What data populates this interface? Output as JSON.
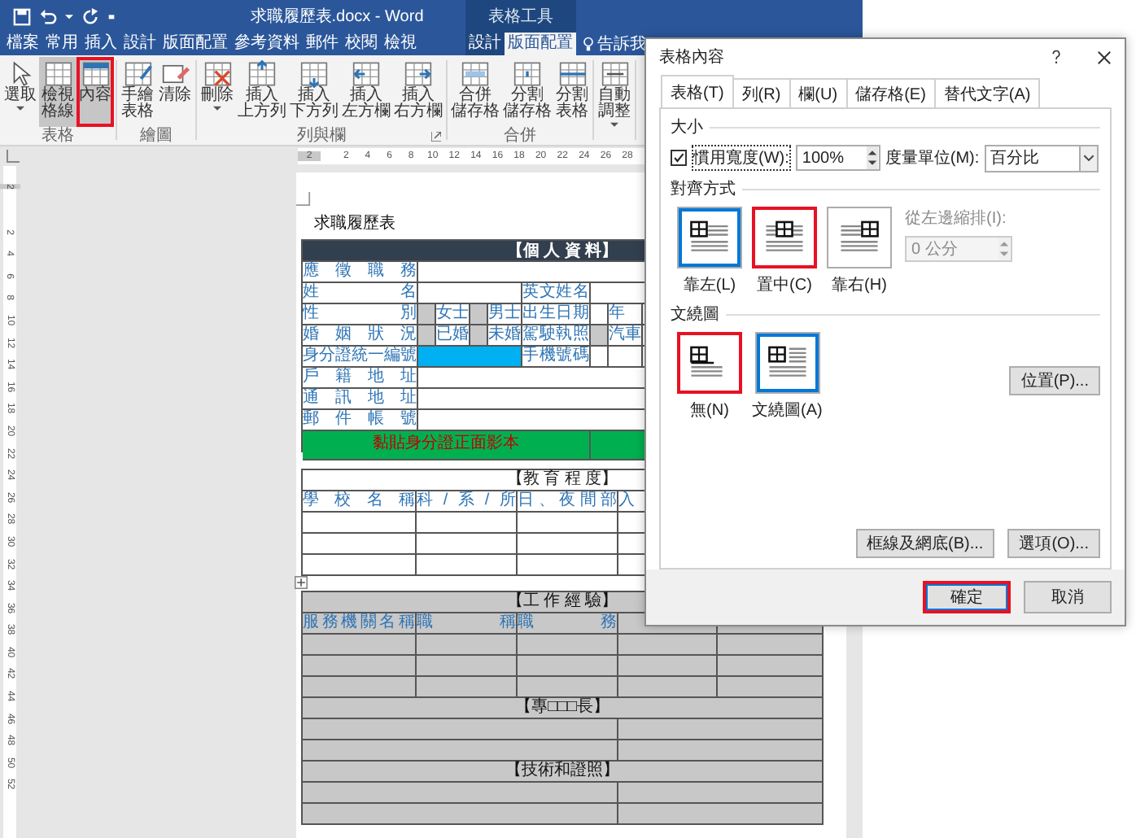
{
  "title_bar": {
    "title": "求職履歷表.docx - Word",
    "context_title": "表格工具"
  },
  "ribbon_tabs": [
    {
      "label": "檔案",
      "selected": false,
      "context": false
    },
    {
      "label": "常用",
      "selected": false,
      "context": false
    },
    {
      "label": "插入",
      "selected": false,
      "context": false
    },
    {
      "label": "設計",
      "selected": false,
      "context": false
    },
    {
      "label": "版面配置",
      "selected": false,
      "context": false
    },
    {
      "label": "參考資料",
      "selected": false,
      "context": false
    },
    {
      "label": "郵件",
      "selected": false,
      "context": false
    },
    {
      "label": "校閱",
      "selected": false,
      "context": false
    },
    {
      "label": "檢視",
      "selected": false,
      "context": false
    },
    {
      "label": "設計",
      "selected": false,
      "context": true
    },
    {
      "label": "版面配置",
      "selected": true,
      "context": true
    }
  ],
  "tell_me": "告訴我",
  "ribbon_groups": [
    {
      "label": "表格",
      "launcher": false,
      "buttons": [
        {
          "label": "選取",
          "pressed": false,
          "highlighted": false,
          "dropdown": true
        },
        {
          "label": "檢視格線",
          "pressed": true,
          "highlighted": false,
          "dropdown": false
        },
        {
          "label": "內容",
          "pressed": false,
          "highlighted": true,
          "dropdown": false
        }
      ]
    },
    {
      "label": "繪圖",
      "launcher": false,
      "buttons": [
        {
          "label": "手繪表格",
          "pressed": false,
          "highlighted": false,
          "dropdown": false
        },
        {
          "label": "清除",
          "pressed": false,
          "highlighted": false,
          "dropdown": false
        }
      ]
    },
    {
      "label": "列與欄",
      "launcher": true,
      "buttons": [
        {
          "label": "刪除",
          "pressed": false,
          "highlighted": false,
          "dropdown": true
        },
        {
          "label": "插入上方列",
          "pressed": false,
          "highlighted": false,
          "dropdown": false
        },
        {
          "label": "插入下方列",
          "pressed": false,
          "highlighted": false,
          "dropdown": false
        },
        {
          "label": "插入左方欄",
          "pressed": false,
          "highlighted": false,
          "dropdown": false
        },
        {
          "label": "插入右方欄",
          "pressed": false,
          "highlighted": false,
          "dropdown": false
        }
      ]
    },
    {
      "label": "合併",
      "launcher": false,
      "buttons": [
        {
          "label": "合併儲存格",
          "pressed": false,
          "highlighted": false,
          "dropdown": false
        },
        {
          "label": "分割儲存格",
          "pressed": false,
          "highlighted": false,
          "dropdown": false
        },
        {
          "label": "分割表格",
          "pressed": false,
          "highlighted": false,
          "dropdown": false
        }
      ]
    },
    {
      "launcher": false,
      "buttons": [
        {
          "label": "自動調整",
          "pressed": false,
          "highlighted": false,
          "dropdown": true
        }
      ]
    }
  ],
  "ruler": {
    "labels": [
      "2",
      "2",
      "4",
      "6",
      "8",
      "10",
      "12",
      "14",
      "16",
      "18",
      "20",
      "22",
      "24",
      "26",
      "28"
    ]
  },
  "vertical_ruler": {
    "labels": [
      "2",
      "2",
      "4",
      "6",
      "8",
      "10",
      "12",
      "14",
      "16",
      "18",
      "20",
      "22",
      "24",
      "26",
      "28",
      "30",
      "32",
      "34",
      "36",
      "38",
      "40",
      "42",
      "44",
      "46",
      "48",
      "50",
      "52"
    ]
  },
  "document": {
    "title": "求職履歷表",
    "personal": {
      "heading": "【個 人 資 料】",
      "rows": [
        [
          {
            "text": "應徵職務",
            "kind": "label"
          },
          {
            "kind": "blank"
          }
        ],
        [
          {
            "text": "姓名",
            "kind": "label"
          },
          {
            "kind": "blank"
          },
          {
            "text": "英文姓名",
            "kind": "label"
          },
          {
            "kind": "blank"
          }
        ],
        [
          {
            "text": "性別",
            "kind": "label"
          },
          {
            "kind": "shaded"
          },
          {
            "text": "女士",
            "kind": "option"
          },
          {
            "kind": "shaded"
          },
          {
            "text": "男士",
            "kind": "option"
          },
          {
            "text": "出生日期",
            "kind": "label"
          },
          {
            "kind": "blank"
          },
          {
            "text": "年",
            "kind": "option"
          },
          {
            "kind": "blank"
          }
        ],
        [
          {
            "text": "婚姻狀況",
            "kind": "label"
          },
          {
            "kind": "shaded"
          },
          {
            "text": "已婚",
            "kind": "option"
          },
          {
            "kind": "shaded"
          },
          {
            "text": "未婚",
            "kind": "option"
          },
          {
            "text": "駕駛執照",
            "kind": "label"
          },
          {
            "kind": "shaded"
          },
          {
            "text": "汽車",
            "kind": "option"
          },
          {
            "kind": "blank"
          }
        ],
        [
          {
            "text": "身分證統一編號",
            "kind": "label"
          },
          {
            "kind": "field"
          },
          {
            "text": "手機號碼",
            "kind": "label"
          },
          {
            "kind": "blank"
          },
          {
            "kind": "blank"
          },
          {
            "kind": "blank"
          }
        ],
        [
          {
            "text": "戶籍地址",
            "kind": "label"
          },
          {
            "kind": "blank"
          }
        ],
        [
          {
            "text": "通訊地址",
            "kind": "label"
          },
          {
            "kind": "blank"
          }
        ],
        [
          {
            "text": "郵件帳號",
            "kind": "label"
          },
          {
            "kind": "blank"
          }
        ],
        [
          {
            "text": "黏貼身分證正面影本",
            "kind": "note"
          },
          {
            "kind": "green"
          }
        ]
      ]
    },
    "education": {
      "heading": "【教 育 程 度】",
      "columns": [
        "學校名稱",
        "科/系/所",
        "日、夜間部",
        "入"
      ],
      "rows": [
        {
          "kind": "empty"
        },
        {
          "kind": "empty"
        },
        {
          "kind": "empty"
        }
      ]
    },
    "work": {
      "heading": "【工 作 經 驗】",
      "columns": [
        "服務機關名稱",
        "職稱",
        "職務"
      ],
      "rows": [
        {
          "kind": "empty"
        },
        {
          "kind": "empty"
        },
        {
          "kind": "empty"
        }
      ]
    },
    "sections": [
      {
        "heading": "【專□□□長】",
        "rows": [
          {
            "kind": "split"
          },
          {
            "kind": "split"
          }
        ]
      },
      {
        "heading": "【技術和證照】",
        "rows": [
          {
            "kind": "split"
          },
          {
            "kind": "split"
          }
        ]
      }
    ]
  },
  "dialog": {
    "title": "表格內容",
    "tabs": [
      {
        "label": "表格(T)",
        "selected": true
      },
      {
        "label": "列(R)",
        "selected": false
      },
      {
        "label": "欄(U)",
        "selected": false
      },
      {
        "label": "儲存格(E)",
        "selected": false
      },
      {
        "label": "替代文字(A)",
        "selected": false
      }
    ],
    "size": {
      "heading": "大小",
      "preferred_width": {
        "label": "慣用寬度(W):",
        "checked": true,
        "value": "100%"
      },
      "unit": {
        "label": "度量單位(M):",
        "value": "百分比"
      }
    },
    "alignment": {
      "heading": "對齊方式",
      "options": [
        {
          "label": "靠左(L)",
          "kind": "left",
          "selected": true,
          "highlighted": false
        },
        {
          "label": "置中(C)",
          "kind": "center",
          "selected": false,
          "highlighted": true
        },
        {
          "label": "靠右(H)",
          "kind": "right",
          "selected": false,
          "highlighted": false
        }
      ],
      "indent": {
        "label": "從左邊縮排(I):",
        "value": "0 公分",
        "disabled": true
      }
    },
    "wrapping": {
      "heading": "文繞圖",
      "options": [
        {
          "label": "無(N)",
          "kind": "none",
          "selected": false,
          "highlighted": true
        },
        {
          "label": "文繞圖(A)",
          "kind": "around",
          "selected": true,
          "highlighted": false
        }
      ],
      "position_button": "位置(P)..."
    },
    "panel_buttons": [
      "框線及網底(B)...",
      "選項(O)..."
    ],
    "footer": [
      {
        "label": "確定",
        "default": true,
        "highlighted": true
      },
      {
        "label": "取消",
        "default": false,
        "highlighted": false
      }
    ]
  }
}
